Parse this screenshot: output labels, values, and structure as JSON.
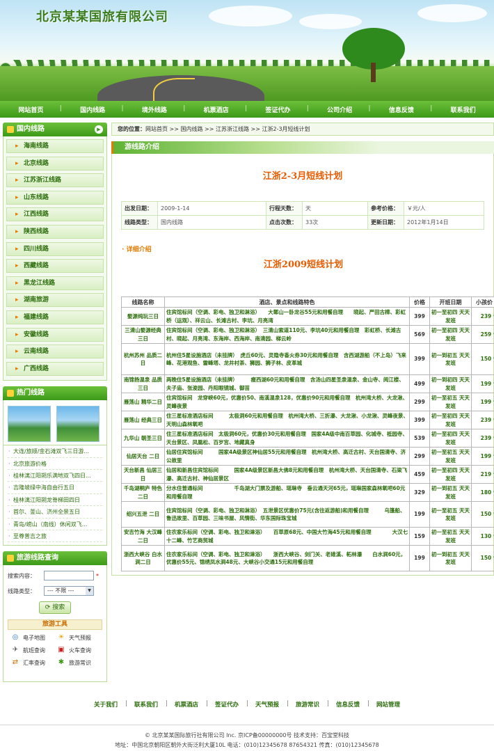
{
  "site": {
    "logo_text": "北京某某国旅有限公司"
  },
  "nav": [
    "网站首页",
    "国内线路",
    "境外线路",
    "机票酒店",
    "签证代办",
    "公司介绍",
    "信息反馈",
    "联系我们"
  ],
  "sidebar": {
    "domestic_title": "国内线路",
    "categories": [
      "海南线路",
      "北京线路",
      "江苏浙江线路",
      "山东线路",
      "江西线路",
      "陕西线路",
      "四川线路",
      "西藏线路",
      "黑龙江线路",
      "湖南旅游",
      "福建线路",
      "安徽线路",
      "云南线路",
      "广西线路"
    ],
    "hot_title": "热门线路",
    "hot_routes": [
      "大连/旅顺/金石滩双飞三日游...",
      "北京旅游价格",
      "桂林漓江阳朔乐满地双飞四日...",
      "吉隆坡绿中海自由行五日",
      "桂林漓江阳朔龙脊梯田四日",
      "首尔、釜山、济州全景五日",
      "青岛/崂山（南线）休闲双飞...",
      "至尊普吉之旅"
    ],
    "search_title": "旅游线路查询",
    "search_label": "搜索内容：",
    "search_value": "",
    "star": "*",
    "type_label": "线路类型：",
    "type_selected": "--- 不限 ---",
    "search_button": "搜索",
    "tools_title": "旅游工具",
    "tools": [
      {
        "label": "电子地图",
        "icon": "globe-icon"
      },
      {
        "label": "天气预报",
        "icon": "weather-icon"
      },
      {
        "label": "航班查询",
        "icon": "flight-icon"
      },
      {
        "label": "火车查询",
        "icon": "train-icon"
      },
      {
        "label": "汇率查询",
        "icon": "exchange-icon"
      },
      {
        "label": "旅游常识",
        "icon": "knowledge-icon"
      }
    ]
  },
  "breadcrumb": {
    "prefix": "您的位置：",
    "path": "网站首页 >> 国内线路 >> 江苏浙江线路 >> 江浙2-3月短线计划"
  },
  "section_title": "游线路介绍",
  "page_title": "江浙2-3月短线计划",
  "info": {
    "depart_label": "出发日期：",
    "depart_value": "2009-1-14",
    "days_label": "行程天数：",
    "days_value": "天",
    "price_label": "参考价格：",
    "price_value": "￥元/人",
    "type_label": "线路类型：",
    "type_value": "国内线路",
    "clicks_label": "点击次数：",
    "clicks_value": "33次",
    "update_label": "更新日期：",
    "update_value": "2012年1月14日"
  },
  "detail_heading": "详细介绍",
  "plan_title": "江浙2009短线计划",
  "route_table": {
    "headers": [
      "线路名称",
      "酒店、景点和线路特色",
      "价格",
      "开班日期",
      "小孩价"
    ],
    "rows": [
      {
        "name": "婺源纯玩三日",
        "desc": "住宾馆标间（空调、彩电、独卫和淋浴）　　大鄣山一卧龙谷55元和用餐自理　　晓起、严田古樟、彩虹桥（运观）、祥云山、长滩古村、李坑、月亮湾",
        "price": "399",
        "sched": "初一至初四 天天发班",
        "kids": "239 含车位"
      },
      {
        "name": "三清山婺源经典　三日",
        "desc": "住宾馆标间（空调、彩电、独卫和淋浴）　三清山索道110元、李坑40元和用餐自理　彩虹桥、长滩古村、晓起、月亮湾、东海岸、西海岸、南清园、梯云岭",
        "price": "569",
        "sched": "初一至初四 天天发班",
        "kids": "259 含车位"
      },
      {
        "name": "杭州苏州 品质二日",
        "desc": "杭州住5星设施酒店（未挂牌）　虎丘60元、灵隐寺香火券30元和用餐自理　含西湖游船（不上岛）飞来峰、花港观鱼、雷峰塔、龙井村茶、狮园、狮子林、皮革城",
        "price": "399",
        "sched": "初一到初五 天天发班",
        "kids": "150 含车位"
      },
      {
        "name": "南锦扬温泉 品质三日",
        "desc": "两晚住5星设施酒店（未挂牌）　　　瘦西湖60元和用餐自理　含汤山四星圣泉温泉、金山寺、阅江楼、夫子庙、张浚园、丹阳眼镜城、御苗",
        "price": "499",
        "sched": "初一到初四 天天发班",
        "kids": "199 含车位"
      },
      {
        "name": "雁荡山 精华二日",
        "desc": "住宾馆标间　龙穿峡60元，优惠价50、南溪温泉128，优惠价90元和用餐自理　杭州湾大桥、大龙湫、灵峰夜景",
        "price": "299",
        "sched": "初一至初五 天天发班",
        "kids": "199 含车位"
      },
      {
        "name": "雁荡山 经典三日",
        "desc": "住三星标准酒店标间　　　太极洞60元和用餐自理　杭州湾大桥、三折瀑、大龙湫、小龙湫、灵峰夜景、天明山森林氧吧",
        "price": "399",
        "sched": "初一至初四 天天发班",
        "kids": "239 含车位"
      },
      {
        "name": "九华山 朝圣三日",
        "desc": "住三星标准酒店标间　太极洞60元，优惠价30元和用餐自理　国家4A级中南百草园、化城寺、祗园寺、天台景区、凤凰松、百岁宫、地藏真身",
        "price": "539",
        "sched": "初一至初四 天天发班",
        "kids": "239 含车位"
      },
      {
        "name": "仙居天台 二日",
        "desc": "仙居住宾馆标间　　　国家4A级景区神仙居55元和用餐自理　杭州湾大桥、高迁古村、天台国清寺、济公故里",
        "price": "299",
        "sched": "初一至初五 天天发班",
        "kids": "199 含车位"
      },
      {
        "name": "天台新昌 仙居三日",
        "desc": "仙居和新昌住宾馆标间　　　国家4A级景区新昌大佛8元和用餐自理　杭州湾大桥、天台国清寺、石梁飞瀑、高迁古村、神仙居景区",
        "price": "459",
        "sched": "初一至初四 天天发班",
        "kids": "219 含车位"
      },
      {
        "name": "千岛湖桐庐 特色二日",
        "desc": "分水住普通标间　　　　　　千岛湖大门票及游船、瑶琳寺　垂云通天河65元，瑶琳国家森林氧吧60元和用餐自理",
        "price": "329",
        "sched": "初一到初五 天天发班",
        "kids": "180 含车位"
      },
      {
        "name": "绍兴五泄 二日",
        "desc": "住宾馆标间（空调、彩电、独卫和淋浴）　五泄景区优惠价75元(含往返游船)和用餐自理　　　乌篷船、鲁迅故里、百草园、三味书屋、风情街、华东国际珠宝城",
        "price": "199",
        "sched": "初一至初五 天天发班",
        "kids": "150 含车位"
      },
      {
        "name": "安吉竹海 大汉峰二日",
        "desc": "住农家乐标间（空调、彩电、独卫和淋浴）　　百草原68元、中国大竹海45元和用餐自理　　　　大汉七十二峰、竹艺商贸城",
        "price": "159",
        "sched": "初一至初五 天天发班",
        "kids": "130 含车位"
      },
      {
        "name": "浙西大峡谷 白水涧二日",
        "desc": "住农家乐标间（空调、彩电、独卫和淋浴）　　浙西大峡谷、剑门关、老碓溪、柘林瀑　　白水涧60元，优惠价55元、锦绣凤水涧48元、大峡谷小交通15元和用餐自理",
        "price": "199",
        "sched": "初一到初五 天天发班",
        "kids": "150 含车位"
      }
    ]
  },
  "footer": {
    "links": [
      "关于我们",
      "联系我们",
      "机票酒店",
      "签证代办",
      "天气预报",
      "旅游常识",
      "信息反馈",
      "网站管理"
    ],
    "copyright": "© 北京某某国际旅行社有限公司 Inc.  京ICP备00000000号  技术支持：百宝堂科技",
    "address": "地址：中国北京朝阳区朝外大街泛利大厦10L  电话：(010)12345678  87654321  传真：(010)12345678"
  }
}
